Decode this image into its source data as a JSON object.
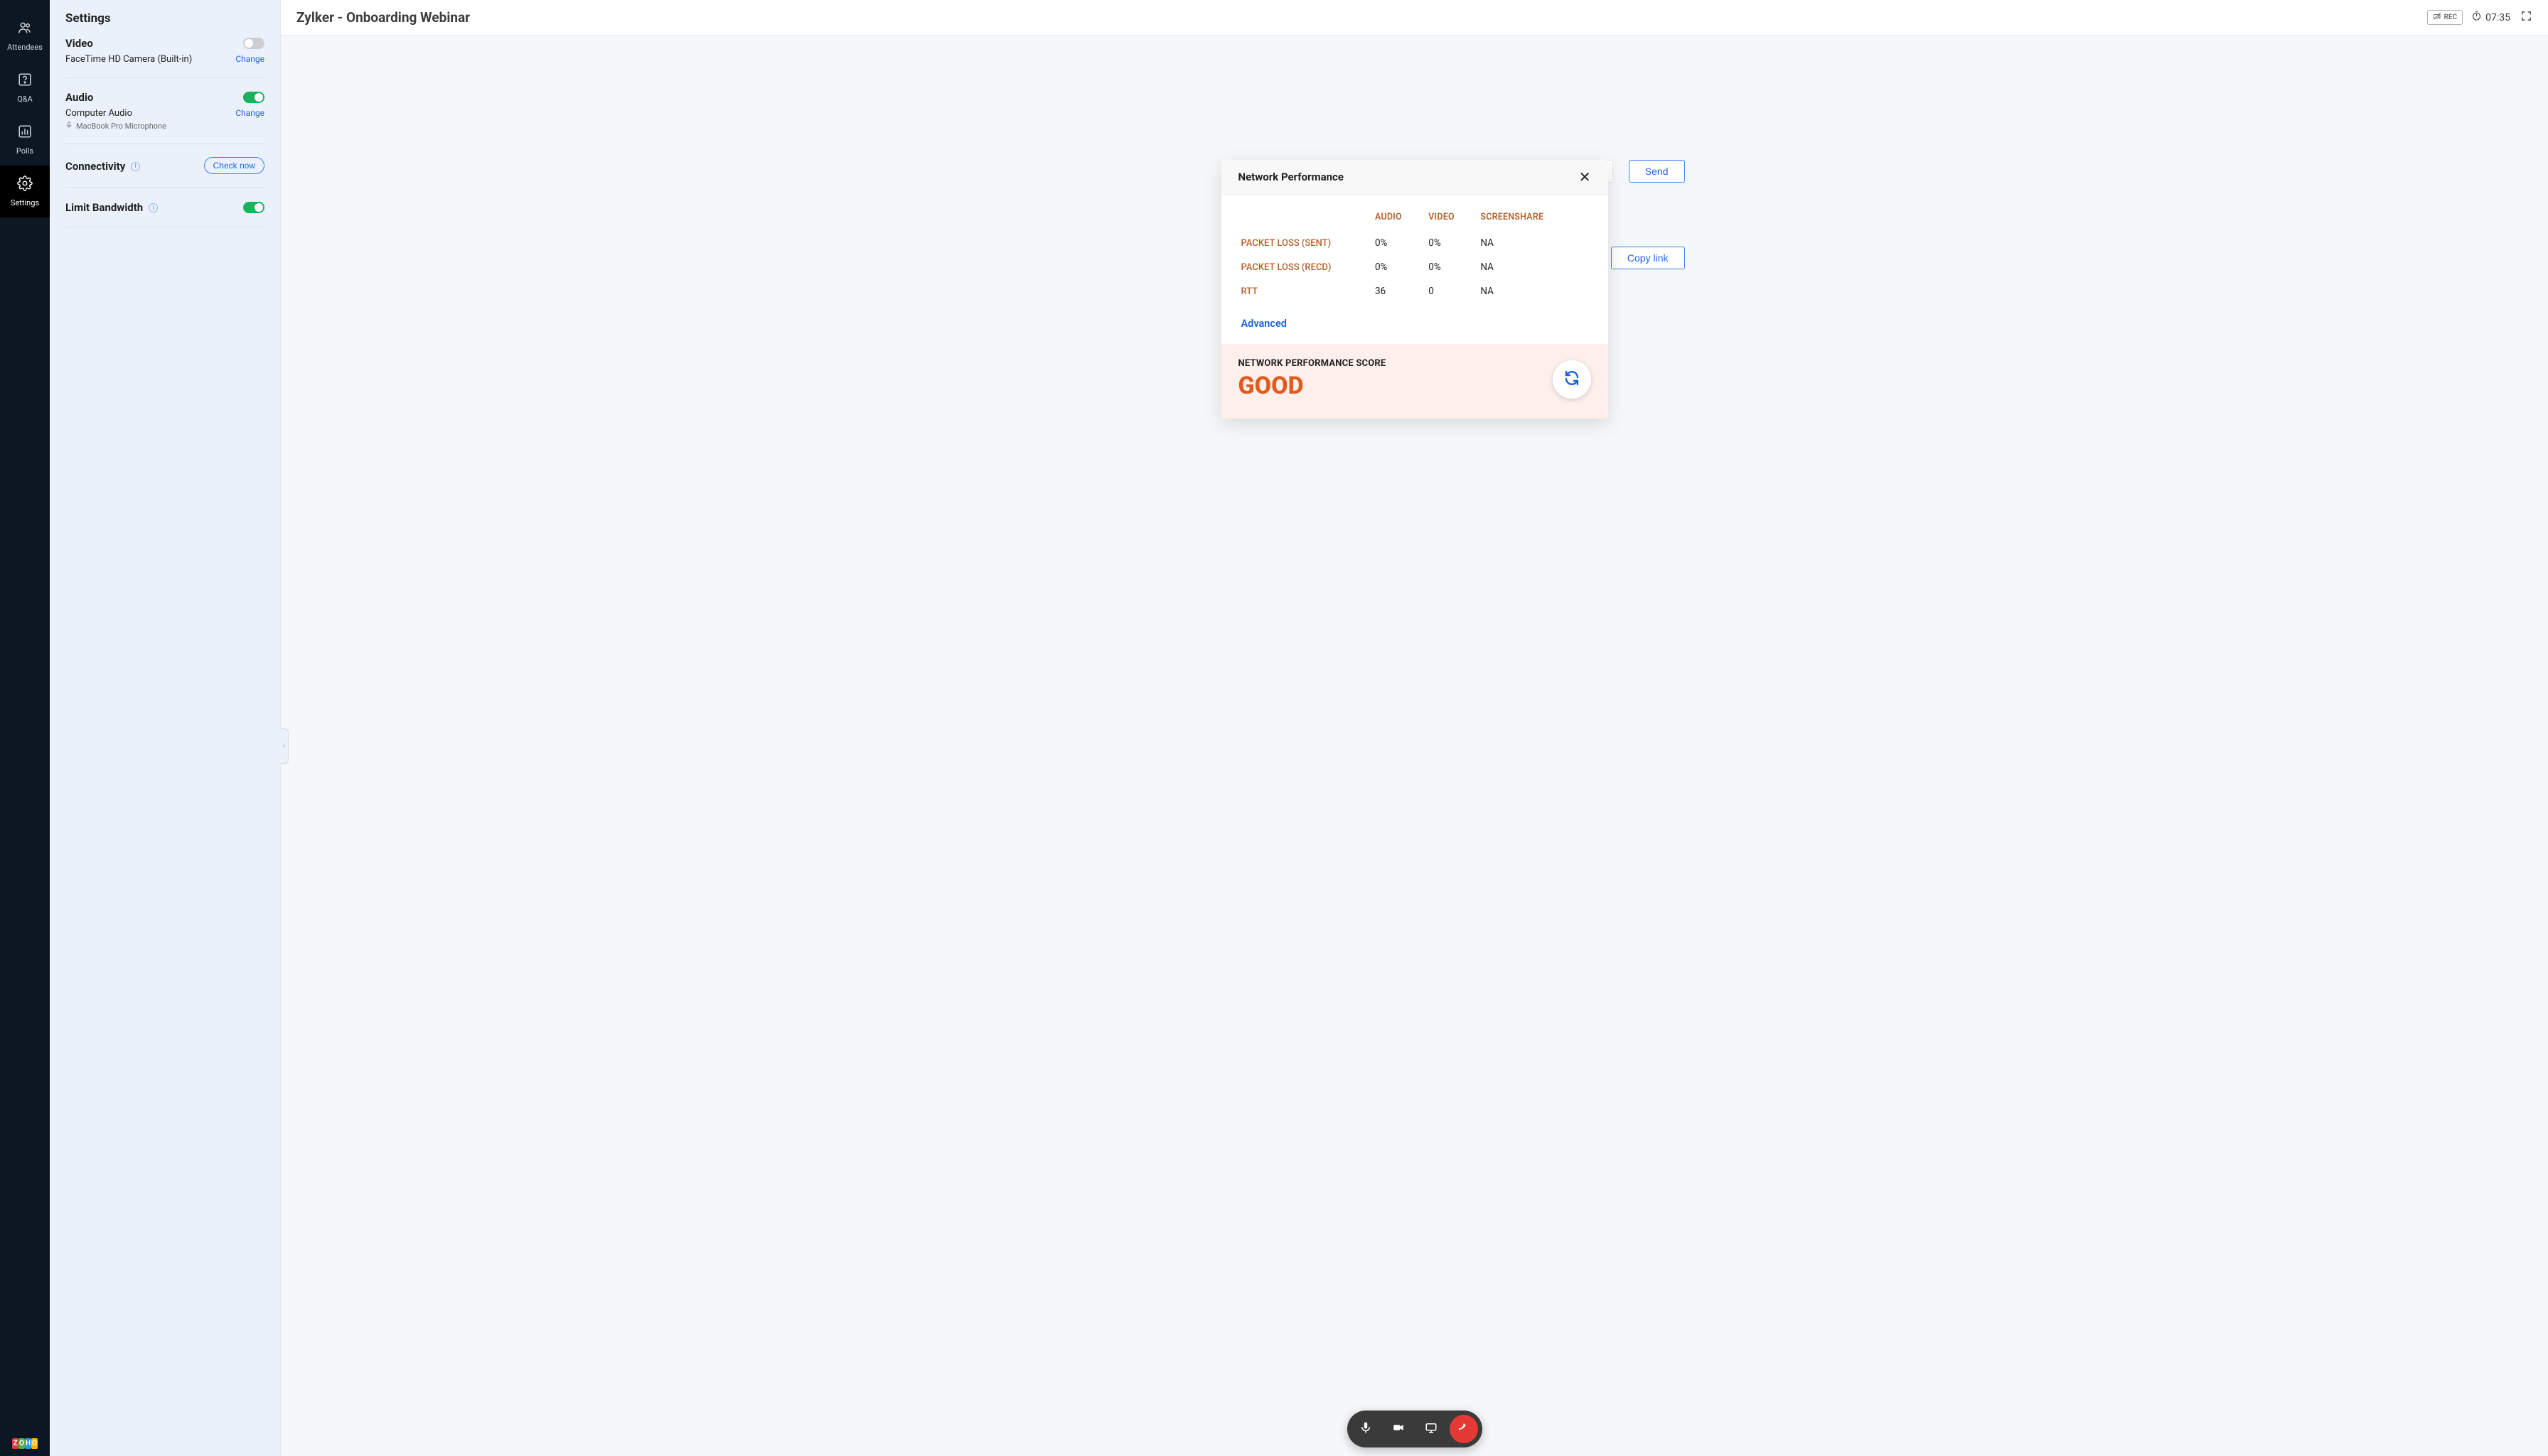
{
  "rail": {
    "items": [
      {
        "label": "Attendees"
      },
      {
        "label": "Q&A"
      },
      {
        "label": "Polls"
      },
      {
        "label": "Settings"
      }
    ]
  },
  "settings": {
    "title": "Settings",
    "video": {
      "heading": "Video",
      "device": "FaceTime HD Camera (Built-in)",
      "change": "Change"
    },
    "audio": {
      "heading": "Audio",
      "device": "Computer Audio",
      "mic": "MacBook Pro Microphone",
      "change": "Change"
    },
    "connectivity": {
      "heading": "Connectivity",
      "check": "Check now"
    },
    "bandwidth": {
      "heading": "Limit Bandwidth"
    }
  },
  "topbar": {
    "title": "Zylker - Onboarding Webinar",
    "rec": "REC",
    "timer": "07:35"
  },
  "invite": {
    "send": "Send",
    "copy": "Copy link"
  },
  "modal": {
    "title": "Network Performance",
    "cols": {
      "audio": "AUDIO",
      "video": "VIDEO",
      "screen": "SCREENSHARE"
    },
    "rows": {
      "pl_sent": {
        "metric": "PACKET LOSS (SENT)",
        "audio": "0%",
        "video": "0%",
        "screen": "NA"
      },
      "pl_recd": {
        "metric": "PACKET LOSS (RECD)",
        "audio": "0%",
        "video": "0%",
        "screen": "NA"
      },
      "rtt": {
        "metric": "RTT",
        "audio": "36",
        "video": "0",
        "screen": "NA"
      }
    },
    "advanced": "Advanced",
    "score_label": "NETWORK PERFORMANCE SCORE",
    "score_value": "GOOD"
  }
}
